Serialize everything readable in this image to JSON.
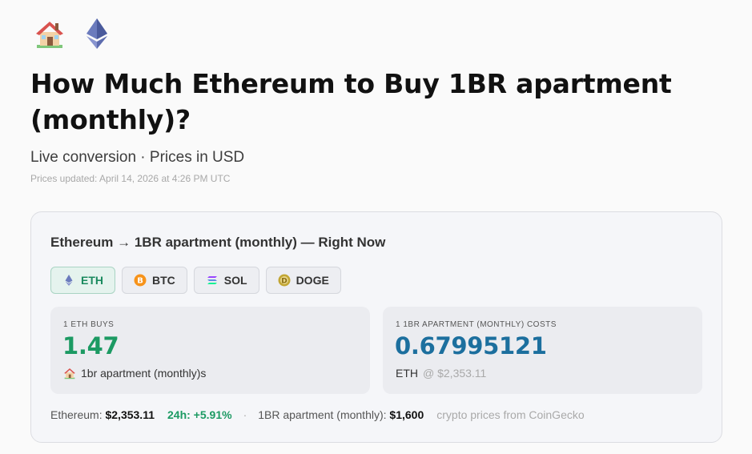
{
  "header": {
    "house_icon": "house-icon",
    "eth_icon": "ethereum-icon",
    "title": "How Much Ethereum to Buy 1BR apartment (monthly)?",
    "subtitle": "Live conversion · Prices in USD",
    "updated": "Prices updated: April 14, 2026 at 4:26 PM UTC"
  },
  "card": {
    "heading": "Ethereum → 1BR apartment (monthly) — Right Now",
    "tabs": [
      {
        "label": "ETH",
        "icon": "ethereum-icon",
        "active": true
      },
      {
        "label": "BTC",
        "icon": "bitcoin-icon",
        "active": false
      },
      {
        "label": "SOL",
        "icon": "solana-icon",
        "active": false
      },
      {
        "label": "DOGE",
        "icon": "dogecoin-icon",
        "active": false
      }
    ],
    "left_panel": {
      "label": "1 ETH BUYS",
      "value": "1.47",
      "sub": "1br apartment (monthly)s"
    },
    "right_panel": {
      "label": "1 1BR APARTMENT (MONTHLY) COSTS",
      "value": "0.67995121",
      "sub_unit": "ETH",
      "sub_at": "@ $2,353.11"
    },
    "footer": {
      "eth_label": "Ethereum:",
      "eth_price": "$2,353.11",
      "change_24h": "24h: +5.91%",
      "sep": "·",
      "item_label": "1BR apartment (monthly):",
      "item_price": "$1,600",
      "source": "crypto prices from CoinGecko"
    }
  },
  "colors": {
    "accent_green": "#1c9a63",
    "accent_blue": "#1c6f9e",
    "eth_purple": "#6b7bbd",
    "btc_orange": "#f7931a",
    "doge_gold": "#c2a633"
  }
}
